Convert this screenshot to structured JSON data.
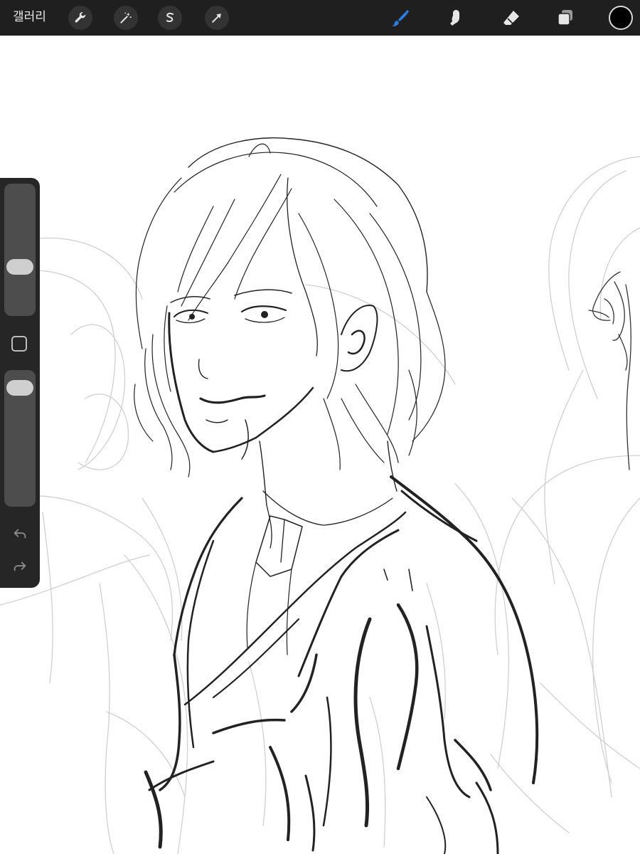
{
  "toolbar": {
    "gallery_label": "갤러리",
    "left_tools": [
      {
        "name": "actions",
        "icon": "wrench-icon"
      },
      {
        "name": "adjustments",
        "icon": "magic-wand-icon"
      },
      {
        "name": "selection",
        "icon": "selection-s-icon"
      },
      {
        "name": "transform",
        "icon": "arrow-cursor-icon"
      }
    ],
    "right_tools": [
      {
        "name": "brush",
        "icon": "brush-icon",
        "active": true
      },
      {
        "name": "smudge",
        "icon": "smudge-finger-icon",
        "active": false
      },
      {
        "name": "eraser",
        "icon": "eraser-icon",
        "active": false
      },
      {
        "name": "layers",
        "icon": "layers-icon",
        "active": false
      }
    ],
    "current_color": "#000000",
    "active_tool_color": "#2a7de1"
  },
  "sidebar": {
    "brush_size_level": 0.35,
    "opacity_level": 0.93,
    "modify_button_icon": "square-outline-icon",
    "undo_icon": "undo-arrow-icon",
    "redo_icon": "redo-arrow-icon"
  },
  "canvas": {
    "background": "#ffffff",
    "content": "pencil-sketch-portrait"
  }
}
